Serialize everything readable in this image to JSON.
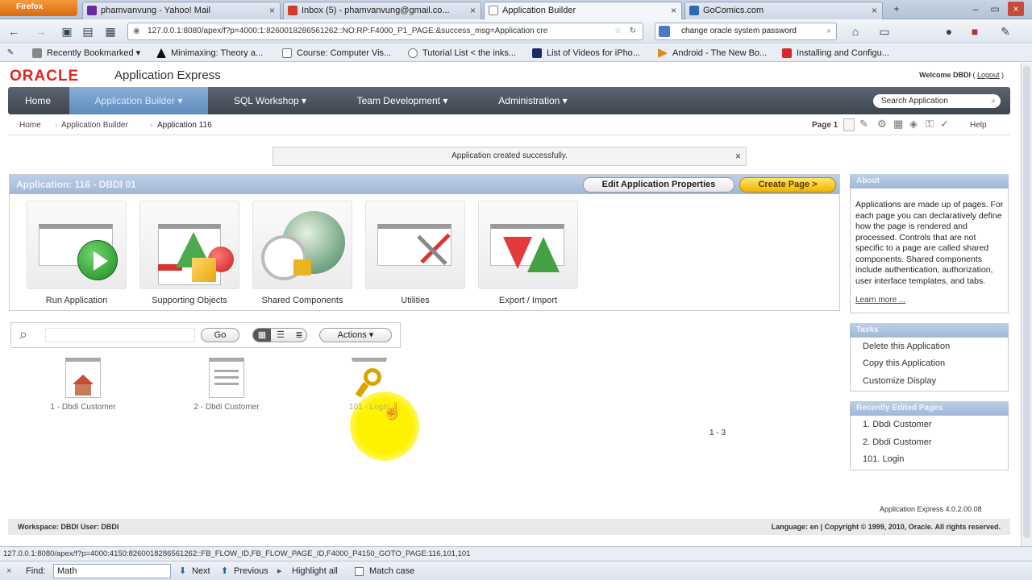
{
  "browser": {
    "app_button": "Firefox",
    "tabs": [
      {
        "title": "phamvanvung - Yahoo! Mail",
        "active": false,
        "icon_color": "#6b2b9e"
      },
      {
        "title": "Inbox (5) - phamvanvung@gmail.co...",
        "active": false,
        "icon_color": "#d23a2a"
      },
      {
        "title": "Application Builder",
        "active": true,
        "icon_color": "#ffffff"
      },
      {
        "title": "GoComics.com",
        "active": false,
        "icon_color": "#2c6bb3"
      }
    ],
    "url": "127.0.0.1:8080/apex/f?p=4000:1:826001828656126​2::NO:RP:F4000_P1_PAGE:&success_msg=Application cre",
    "search_text": "change oracle system password",
    "bookmarks": [
      "Recently Bookmarked",
      "Minimaxing: Theory a...",
      "Course: Computer Vis...",
      "Tutorial List < the inks...",
      "List of Videos for iPho...",
      "Android - The New Bo...",
      "Installing and Configu..."
    ],
    "status_url": "127.0.0.1:8080/apex/f?p=4000:4150:8260018286561262::FB_FLOW_ID,FB_FLOW_PAGE_ID,F4000_P4150_GOTO_PAGE:116,101,101",
    "find": {
      "label": "Find:",
      "value": "Math",
      "next": "Next",
      "previous": "Previous",
      "highlight": "Highlight all",
      "match_case": "Match case"
    }
  },
  "apex": {
    "logo": "ORACLE",
    "product": "Application Express",
    "welcome": "Welcome DBDI",
    "logout": "Logout",
    "nav": [
      {
        "label": "Home"
      },
      {
        "label": "Application Builder ▾"
      },
      {
        "label": "SQL Workshop ▾"
      },
      {
        "label": "Team Development ▾"
      },
      {
        "label": "Administration ▾"
      }
    ],
    "search_placeholder": "Search Application",
    "breadcrumb": [
      "Home",
      "Application Builder",
      "Application 116"
    ],
    "page_label": "Page 1",
    "help": "Help",
    "success_message": "Application created successfully.",
    "app_title": "Application: 116 - DBDI 01",
    "edit_props": "Edit Application Properties",
    "create_page": "Create Page >",
    "tools": [
      "Run Application",
      "Supporting Objects",
      "Shared Components",
      "Utilities",
      "Export / Import"
    ],
    "go": "Go",
    "actions": "Actions ▾",
    "pages": [
      "1 - Dbdi Customer",
      "2 - Dbdi Customer",
      "101 - Login"
    ],
    "pagination": "1 - 3",
    "about_title": "About",
    "about_text": "Applications are made up of pages. For each page you can declaratively define how the page is rendered and processed. Controls that are not specific to a page are called shared components. Shared components include authentication, authorization, user interface templates, and tabs.",
    "learn_more": "Learn more ...",
    "tasks_title": "Tasks",
    "tasks": [
      "Delete this Application",
      "Copy this Application",
      "Customize Display"
    ],
    "recent_title": "Recently Edited Pages",
    "recent": [
      "1. Dbdi Customer",
      "2. Dbdi Customer",
      "101. Login"
    ],
    "version": "Application Express 4.0.2.00.08",
    "footer_left": "Workspace: DBDI User: DBDI",
    "footer_right": "Language: en | Copyright © 1999, 2010, Oracle. All rights reserved."
  }
}
